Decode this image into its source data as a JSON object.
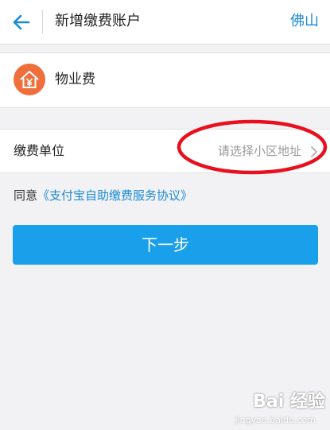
{
  "header": {
    "title": "新增缴费账户",
    "city": "佛山"
  },
  "payment_type": {
    "label": "物业费",
    "icon": "house-yen-icon",
    "icon_color": "#ef6f3c"
  },
  "payment_unit": {
    "label": "缴费单位",
    "placeholder": "请选择小区地址"
  },
  "agreement": {
    "prefix": "同意",
    "link": "《支付宝自助缴费服务协议》"
  },
  "next_button": {
    "label": "下一步"
  },
  "watermark": {
    "main": "Bai 经验",
    "sub": "jingyan.baidu.com"
  },
  "colors": {
    "accent": "#1a8ad6",
    "button": "#1aa0ea",
    "annotation": "#e8101e"
  }
}
